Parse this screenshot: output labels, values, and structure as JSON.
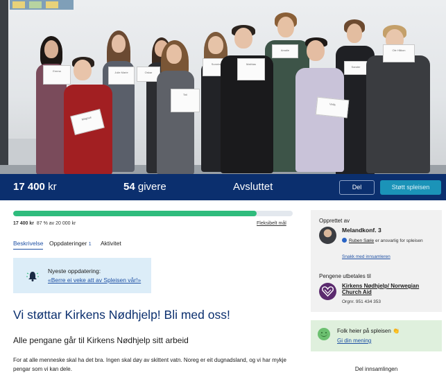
{
  "hero": {
    "signs": [
      "Emma",
      "Julie Marie",
      "Oskar",
      "Tiril",
      "Sunniva",
      "Mathias",
      "Amalie",
      "Jonas",
      "Magnus",
      "Vetle",
      "Sander",
      "Ole Håkon"
    ]
  },
  "stats": {
    "amount_value": "17 400",
    "amount_unit": "kr",
    "givers_value": "54",
    "givers_label": "givere",
    "status": "Avsluttet",
    "share_button": "Del",
    "support_button": "Støtt spleisen"
  },
  "progress": {
    "fraction": 0.87,
    "amount": "17 400 kr",
    "detail": "87 % av 20 000 kr",
    "flexible_goal": "Fleksibelt mål"
  },
  "tabs": {
    "description": "Beskrivelse",
    "updates": "Oppdateringer",
    "updates_count": "1",
    "activity": "Aktivitet"
  },
  "update_box": {
    "label": "Nyeste oppdatering:",
    "link": "«Berre ei veke att av Spleisen vår!»"
  },
  "main": {
    "title": "Vi støttar Kirkens Nødhjelp! Bli med oss!",
    "subtitle": "Alle pengane går til Kirkens Nødhjelp sitt arbeid",
    "paragraph": "For at alle menneske skal ha det bra. Ingen skal døy av skittent vatn. Noreg er eit dugnadsland, og vi har mykje pengar som vi kan dele."
  },
  "sidebar": {
    "created_by_label": "Opprettet av",
    "creator": "Melandkonf. 3",
    "responsible_name": "Ruben Sæle",
    "responsible_text": "er ansvarlig for spleisen",
    "contact_link": "Snakk med innsamleren",
    "paid_to_label": "Pengene utbetales til",
    "recipient": "Kirkens Nødhjelp/ Norwegian Church Aid",
    "org_number": "Orgnr. 951 434 353",
    "cheer_text": "Folk heier på spleisen 👏",
    "cheer_link": "Gi din mening",
    "share_collection": "Del innsamlingen"
  },
  "colors": {
    "navy": "#0b2f6e",
    "accent_teal": "#1b93b8",
    "progress_green": "#2fbc7d",
    "link_blue": "#1d4fa3"
  }
}
